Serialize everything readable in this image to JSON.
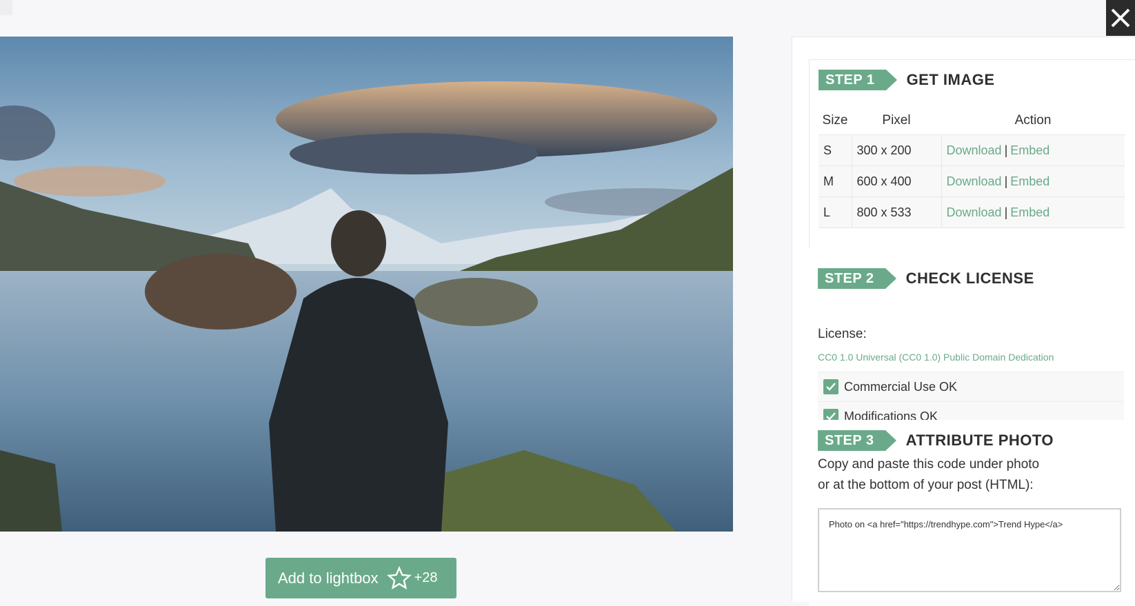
{
  "window": {
    "close_label": "close"
  },
  "lightbox": {
    "label": "Add to lightbox",
    "count": "+28"
  },
  "step1": {
    "badge": "STEP 1",
    "title": "GET IMAGE",
    "headers": [
      "Size",
      "Pixel",
      "Action"
    ],
    "rows": [
      {
        "size": "S",
        "pixel": "300 x 200",
        "download": "Download",
        "sep": "|",
        "embed": "Embed"
      },
      {
        "size": "M",
        "pixel": "600 x 400",
        "download": "Download",
        "sep": "|",
        "embed": "Embed"
      },
      {
        "size": "L",
        "pixel": "800 x 533",
        "download": "Download",
        "sep": "|",
        "embed": "Embed"
      }
    ]
  },
  "step2": {
    "badge": "STEP 2",
    "title": "CHECK LICENSE",
    "license_label": "License:",
    "license_link": "CC0 1.0 Universal (CC0 1.0) Public Domain Dedication",
    "checks": [
      "Commercial Use OK",
      "Modifications OK"
    ]
  },
  "step3": {
    "badge": "STEP 3",
    "title": "ATTRIBUTE PHOTO",
    "instructions_line1": "Copy and paste this code under photo",
    "instructions_line2": "or at the bottom of your post (HTML):",
    "code": "Photo on <a href=\"https://trendhype.com\">Trend Hype</a>"
  },
  "colors": {
    "accent": "#6aaa8a",
    "close_bg": "#2b2b2b"
  },
  "icons": {
    "close": "close-icon",
    "star": "star-icon",
    "check": "checkmark-icon"
  }
}
